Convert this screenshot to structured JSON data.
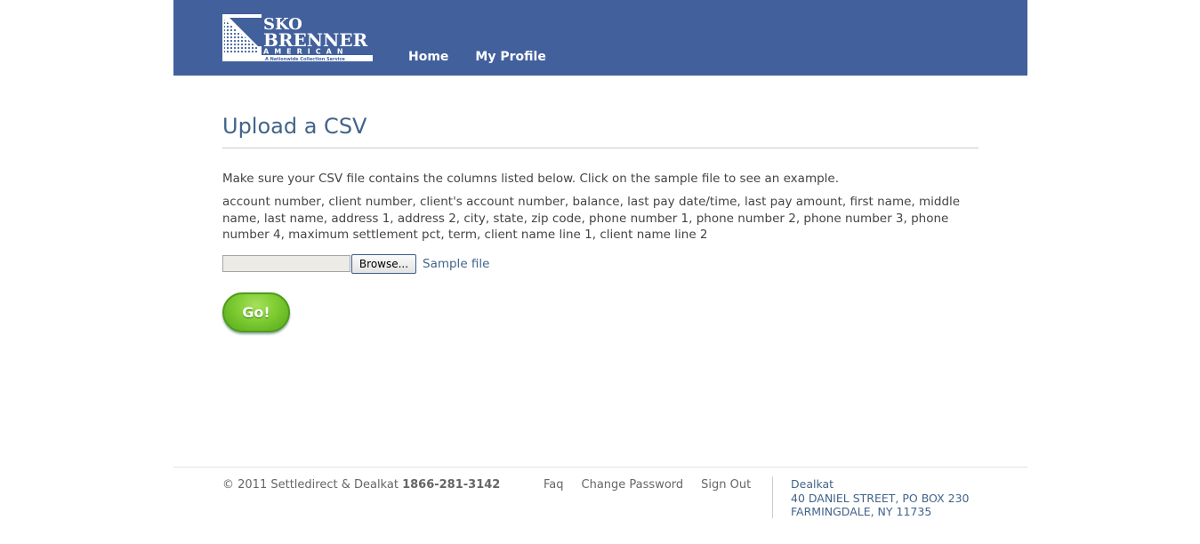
{
  "header": {
    "logo": {
      "line1": "SKO",
      "line2": "BRENNER",
      "line3": "AMERICAN",
      "tagline": "A Nationwide Collection Service"
    },
    "nav": [
      {
        "label": "Home"
      },
      {
        "label": "My Profile"
      }
    ]
  },
  "main": {
    "title": "Upload a CSV",
    "intro": "Make sure your CSV file contains the columns listed below. Click on the sample file to see an example.",
    "columns": "account number, client number, client's account number, balance, last pay date/time, last pay amount, first name, middle name, last name, address 1, address 2, city, state, zip code, phone number 1, phone number 2, phone number 3, phone number 4, maximum settlement pct, term, client name line 1, client name line 2",
    "browse_label": "Browse...",
    "file_value": "",
    "sample_link": "Sample file",
    "go_label": "Go!"
  },
  "footer": {
    "copyright": "© 2011 Settledirect & Dealkat",
    "phone": "1866-281-3142",
    "links": [
      {
        "label": "Faq"
      },
      {
        "label": "Change Password"
      },
      {
        "label": "Sign Out"
      }
    ],
    "address": {
      "company": "Dealkat",
      "street": "40 DANIEL STREET, PO BOX 230",
      "city": "FARMINGDALE, NY 11735"
    }
  },
  "colors": {
    "header_bg": "#42609c",
    "title": "#42648a",
    "go_button": "#7fcc32"
  }
}
